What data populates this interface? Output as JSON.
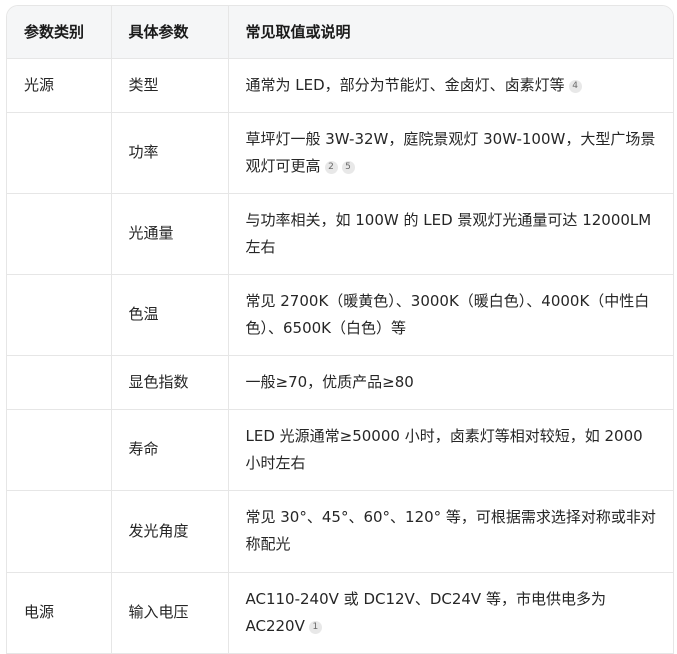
{
  "header": {
    "col1": "参数类别",
    "col2": "具体参数",
    "col3": "常见取值或说明"
  },
  "rows": [
    {
      "category": "光源",
      "param": "类型",
      "desc": "通常为 LED，部分为节能灯、金卤灯、卤素灯等",
      "cites": [
        "4"
      ]
    },
    {
      "category": "",
      "param": "功率",
      "desc": "草坪灯一般 3W-32W，庭院景观灯 30W-100W，大型广场景观灯可更高",
      "cites": [
        "2",
        "5"
      ]
    },
    {
      "category": "",
      "param": "光通量",
      "desc": "与功率相关，如 100W 的 LED 景观灯光通量可达 12000LM 左右",
      "cites": []
    },
    {
      "category": "",
      "param": "色温",
      "desc": "常见 2700K（暖黄色）、3000K（暖白色）、4000K（中性白色）、6500K（白色）等",
      "cites": []
    },
    {
      "category": "",
      "param": "显色指数",
      "desc": "一般≥70，优质产品≥80",
      "cites": []
    },
    {
      "category": "",
      "param": "寿命",
      "desc": "LED 光源通常≥50000 小时，卤素灯等相对较短，如 2000 小时左右",
      "cites": []
    },
    {
      "category": "",
      "param": "发光角度",
      "desc": "常见 30°、45°、60°、120° 等，可根据需求选择对称或非对称配光",
      "cites": []
    },
    {
      "category": "电源",
      "param": "输入电压",
      "desc": "AC110-240V 或 DC12V、DC24V 等，市电供电多为 AC220V",
      "cites": [
        "1"
      ]
    }
  ]
}
